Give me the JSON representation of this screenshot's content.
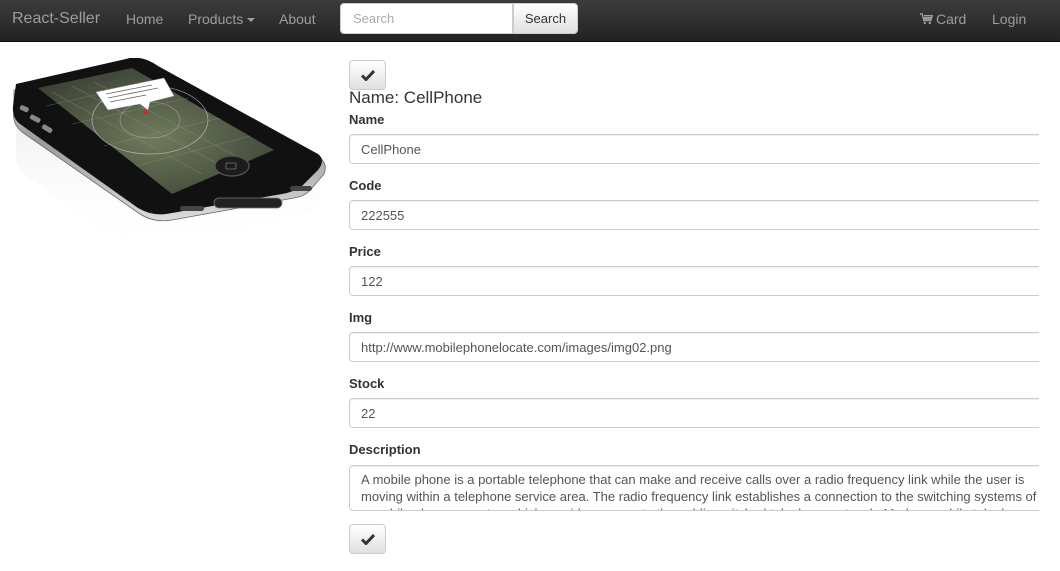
{
  "navbar": {
    "brand": "React-Seller",
    "links": {
      "home": "Home",
      "products": "Products",
      "about": "About"
    },
    "search": {
      "placeholder": "Search",
      "value": "",
      "button_label": "Search"
    },
    "cart_label": "Card",
    "login_label": "Login",
    "icons": {
      "products_dropdown": "caret-down-icon",
      "cart": "shopping-cart-icon"
    },
    "colors": {
      "background": "#222222",
      "link": "#9d9d9d"
    }
  },
  "product": {
    "image_description": "iPhone 4 showing map application",
    "heading": "Name: CellPhone"
  },
  "form": {
    "fields": {
      "name": {
        "label": "Name",
        "value": "CellPhone"
      },
      "code": {
        "label": "Code",
        "value": "222555"
      },
      "price": {
        "label": "Price",
        "value": "122"
      },
      "img": {
        "label": "Img",
        "value": "http://www.mobilephonelocate.com/images/img02.png"
      },
      "stock": {
        "label": "Stock",
        "value": "22"
      },
      "description": {
        "label": "Description",
        "value": "A mobile phone is a portable telephone that can make and receive calls over a radio frequency link while the user is moving within a telephone service area. The radio frequency link establishes a connection to the switching systems of a mobile phone operator, which provides access to the public switched telephone network. Modern mobile telephone services use a cellular network architecture, and, therefore, mobile telephones are often also called cellular telephones or cell phones."
      }
    },
    "buttons": {
      "top_icon": "check-icon",
      "bottom_icon": "check-icon"
    }
  }
}
